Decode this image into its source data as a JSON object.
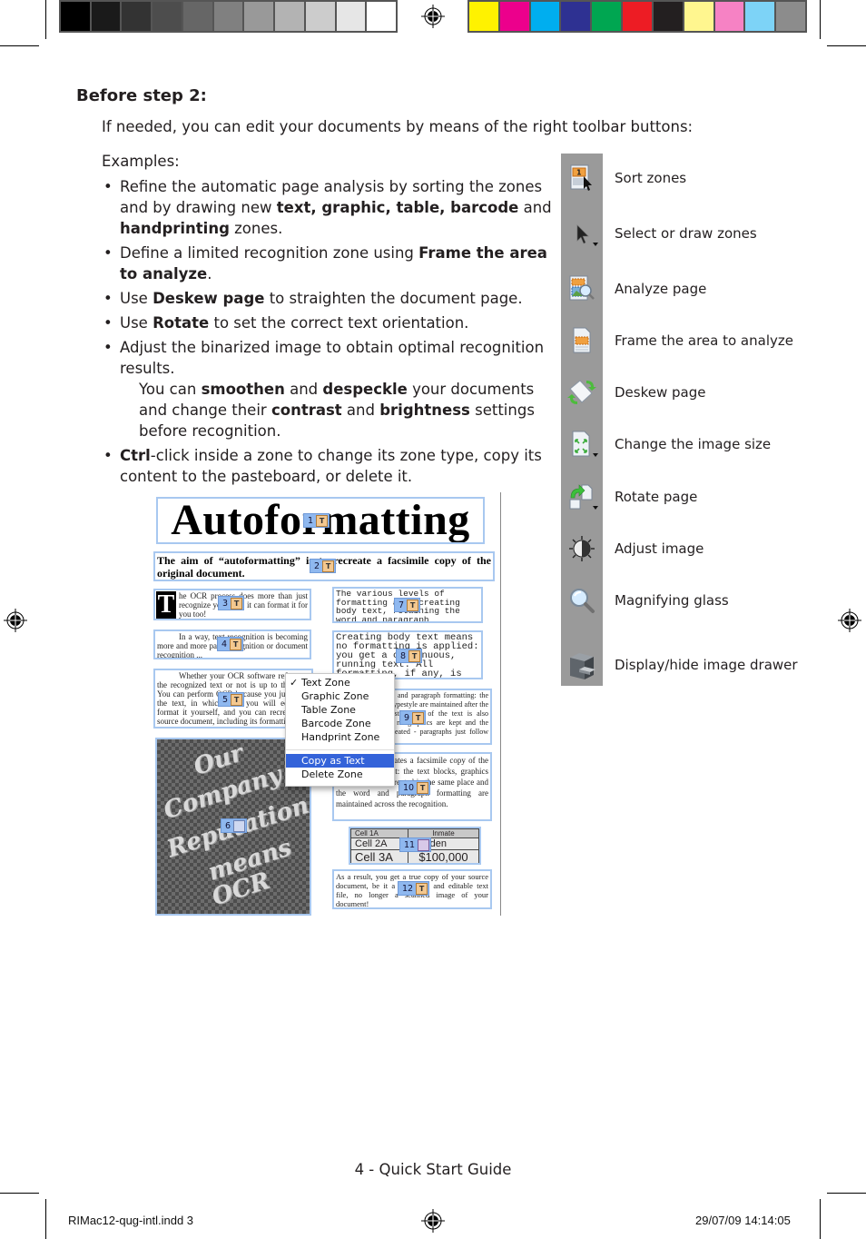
{
  "print_marks": {
    "grayscale_swatches": [
      "#000000",
      "#1a1a1a",
      "#333333",
      "#4d4d4d",
      "#666666",
      "#808080",
      "#999999",
      "#b3b3b3",
      "#cccccc",
      "#e6e6e6",
      "#ffffff"
    ],
    "color_swatches": [
      "#fff200",
      "#ec008c",
      "#00aeef",
      "#2e3192",
      "#00a651",
      "#ed1c24",
      "#231f20",
      "#fff68f",
      "#f682c4",
      "#7dd3f7",
      "#8c8c8c"
    ]
  },
  "section": {
    "heading": "Before step 2:",
    "intro": "If needed, you can edit your documents by means of the right toolbar buttons:",
    "examples_label": "Examples:",
    "bullets": [
      {
        "parts": [
          "Refine the automatic page analysis by sorting the zones and by drawing new ",
          "text, graphic, table, barcode",
          " and ",
          "handprinting",
          " zones."
        ]
      },
      {
        "parts": [
          "Define a limited recognition zone using ",
          "Frame the area to analyze",
          "."
        ]
      },
      {
        "parts": [
          "Use ",
          "Deskew page",
          " to straighten the document page."
        ]
      },
      {
        "parts": [
          "Use ",
          "Rotate",
          " to set the correct text orientation."
        ]
      },
      {
        "parts": [
          "Adjust the binarized image to obtain optimal recognition results."
        ],
        "sub": [
          "You can ",
          "smoothen",
          " and ",
          "despeckle",
          " your documents and change their ",
          "contrast",
          " and ",
          "brightness",
          " settings before recognition."
        ]
      },
      {
        "parts": [
          "Ctrl",
          "-click inside a zone to change its zone type, copy its content to the pasteboard, or delete it."
        ]
      }
    ]
  },
  "toolbar": {
    "items": [
      {
        "icon": "sort-zones-icon",
        "label": "Sort zones"
      },
      {
        "icon": "select-draw-zones-icon",
        "label": "Select or draw zones"
      },
      {
        "icon": "analyze-page-icon",
        "label": "Analyze page"
      },
      {
        "icon": "frame-area-icon",
        "label": "Frame the area to analyze"
      },
      {
        "icon": "deskew-page-icon",
        "label": "Deskew page"
      },
      {
        "icon": "change-image-size-icon",
        "label": "Change the image size"
      },
      {
        "icon": "rotate-page-icon",
        "label": "Rotate page"
      },
      {
        "icon": "adjust-image-icon",
        "label": "Adjust image"
      },
      {
        "icon": "magnifying-glass-icon",
        "label": "Magnifying glass"
      },
      {
        "icon": "image-drawer-icon",
        "label": "Display/hide image drawer"
      }
    ]
  },
  "screenshot": {
    "title_zone": "Autoformatting",
    "zone2": "The aim of “autoformatting” is to recreate a facsimile copy of the original document.",
    "zone3_dropcap": "T",
    "zone3": "he OCR process does more than just recognize your text: it can format it for you too!",
    "zone4": "In a way, text recognition is becoming more and more page recognition or document recognition ...",
    "zone5": "Whether your OCR software reformats the recognized text or not is up to the user. You can perform OCR because you just want the text, in which case you will edit and format it yourself, and you can recreate the source document, including its formatting.",
    "zone6_lines": [
      "Our",
      "Company",
      "Reputation",
      "means",
      "OCR"
    ],
    "zone7": "The various levels of formatting are: creating body text, retaining the word and paragraph formatting and creating a facsimile copy.",
    "zone8": "Creating body text means no formatting is applied: you get a continuous, running text. All formatting, if any, is done afterwards by",
    "zone9": "Retaining the word and paragraph formatting: the font type, size and typestyle are maintained after the recognition, the justification of the text is also retained. However, no graphics are kept and the columns aren't recreated - paragraphs just follow each other etc.",
    "zone10": "“Facsimile” recreates a facsimile copy of the original document: the text blocks, graphics and tables are recreated in the same place and the word and paragraph formatting are maintained across the recognition.",
    "zone11_table": [
      [
        "Cell  1A",
        "Inmate"
      ],
      [
        "Cell  2A",
        "Warden"
      ],
      [
        "Cell  3A",
        "$100,000"
      ]
    ],
    "zone12": "As a result, you get a true copy of your source document, be it a converted and editable text file, no longer a scanned image of your document!",
    "badges": [
      "1",
      "2",
      "3",
      "4",
      "5",
      "6",
      "7",
      "8",
      "9",
      "10",
      "11",
      "12"
    ],
    "badge_text_glyph": "T",
    "context_menu": {
      "items": [
        "Text Zone",
        "Graphic Zone",
        "Table Zone",
        "Barcode Zone",
        "Handprint Zone",
        "Copy as Text",
        "Delete Zone"
      ],
      "checked": "Text Zone",
      "highlighted": "Copy as Text",
      "check_glyph": "✓"
    }
  },
  "footer": {
    "page_label": "4 - Quick Start Guide",
    "slug_file": "RIMac12-qug-intl.indd   3",
    "slug_date": "29/07/09   14:14:05"
  }
}
